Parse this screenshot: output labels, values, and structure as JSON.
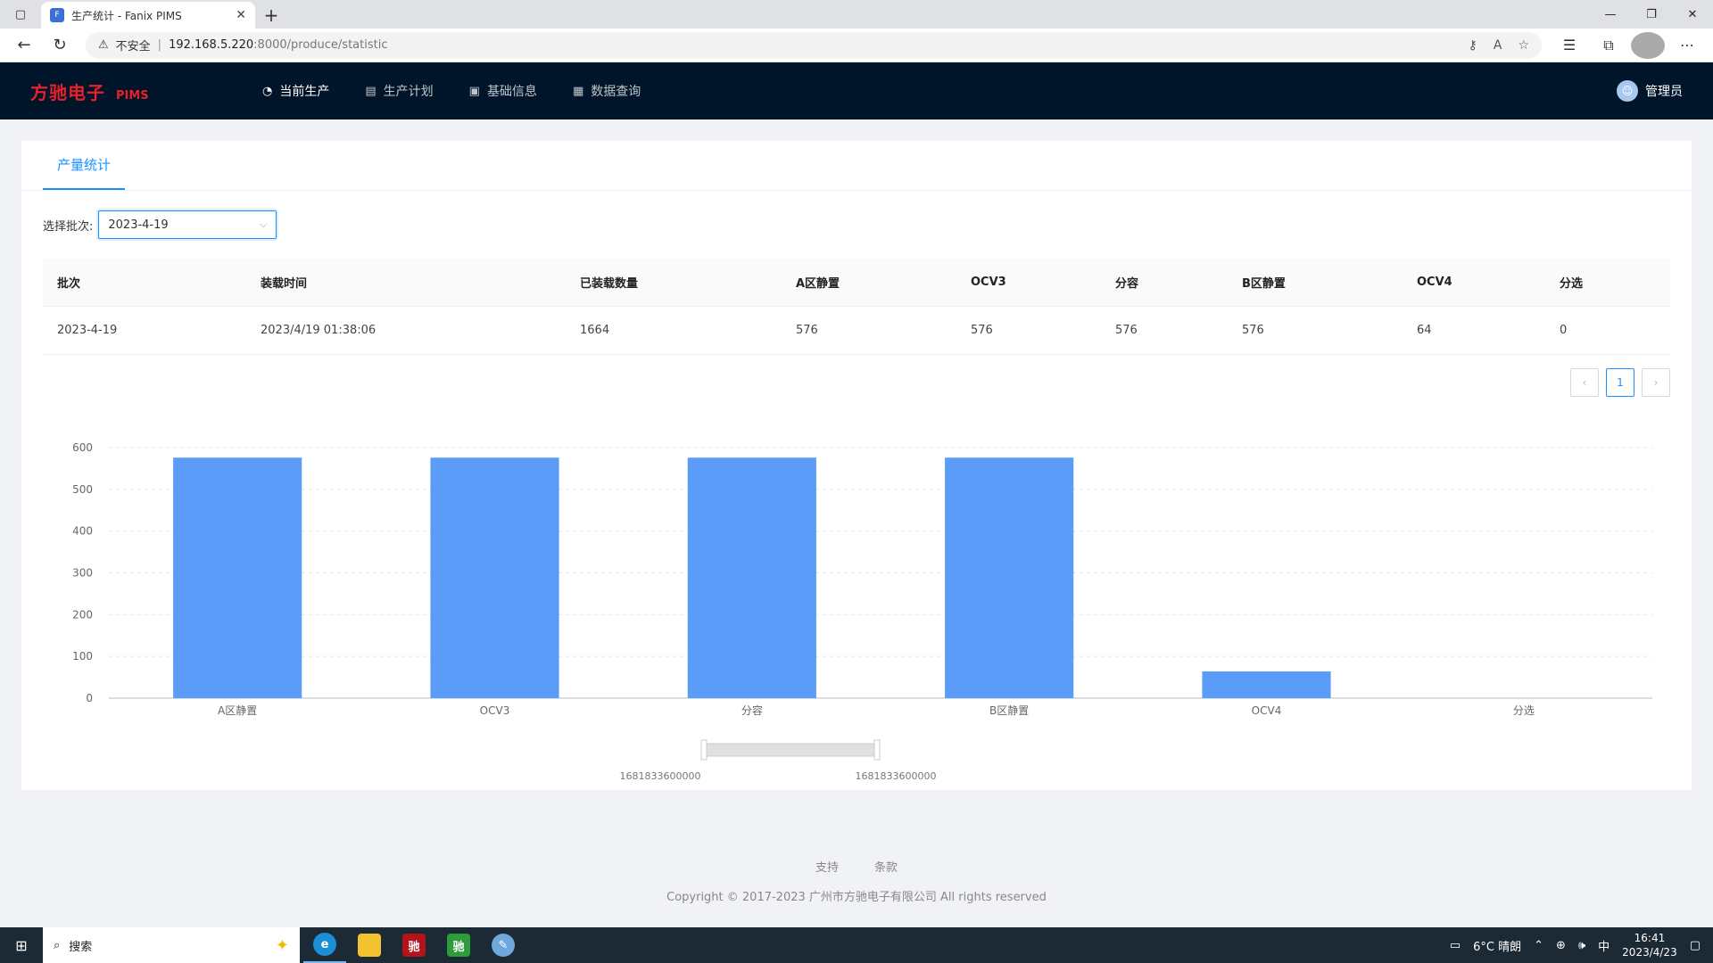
{
  "browser": {
    "tab_title": "生产统计 - Fanix PIMS",
    "tab_close": "✕",
    "new_tab": "+",
    "security_label": "不安全",
    "url_host": "192.168.5.220",
    "url_path": ":8000/produce/statistic"
  },
  "header": {
    "brand_cn": "方驰电子",
    "brand_en": "PIMS",
    "menu": [
      {
        "label": "当前生产",
        "icon": "dashboard-icon"
      },
      {
        "label": "生产计划",
        "icon": "calendar-icon"
      },
      {
        "label": "基础信息",
        "icon": "info-icon"
      },
      {
        "label": "数据查询",
        "icon": "table-icon"
      }
    ],
    "user_name": "管理员"
  },
  "page": {
    "tab_label": "产量统计",
    "filter_label": "选择批次:",
    "filter_value": "2023-4-19"
  },
  "table": {
    "columns": [
      "批次",
      "装载时间",
      "已装载数量",
      "A区静置",
      "OCV3",
      "分容",
      "B区静置",
      "OCV4",
      "分选"
    ],
    "rows": [
      [
        "2023-4-19",
        "2023/4/19 01:38:06",
        "1664",
        "576",
        "576",
        "576",
        "576",
        "64",
        "0"
      ]
    ]
  },
  "pagination": {
    "current": "1"
  },
  "chart_data": {
    "type": "bar",
    "categories": [
      "A区静置",
      "OCV3",
      "分容",
      "B区静置",
      "OCV4",
      "分选"
    ],
    "values": [
      576,
      576,
      576,
      576,
      64,
      0
    ],
    "y_ticks": [
      "0",
      "100",
      "200",
      "300",
      "400",
      "500",
      "600"
    ],
    "ylim": [
      0,
      600
    ],
    "grid": true,
    "bar_color": "#5b9cf8",
    "datazoom_labels": [
      "1681833600000",
      "1681833600000"
    ]
  },
  "footer": {
    "links": [
      "支持",
      "条款"
    ],
    "copyright": "Copyright © 2017-2023 广州市方驰电子有限公司 All rights reserved"
  },
  "taskbar": {
    "search_label": "搜索",
    "weather": "6°C 晴朗",
    "ime": "中",
    "time": "16:41",
    "date": "2023/4/23"
  }
}
